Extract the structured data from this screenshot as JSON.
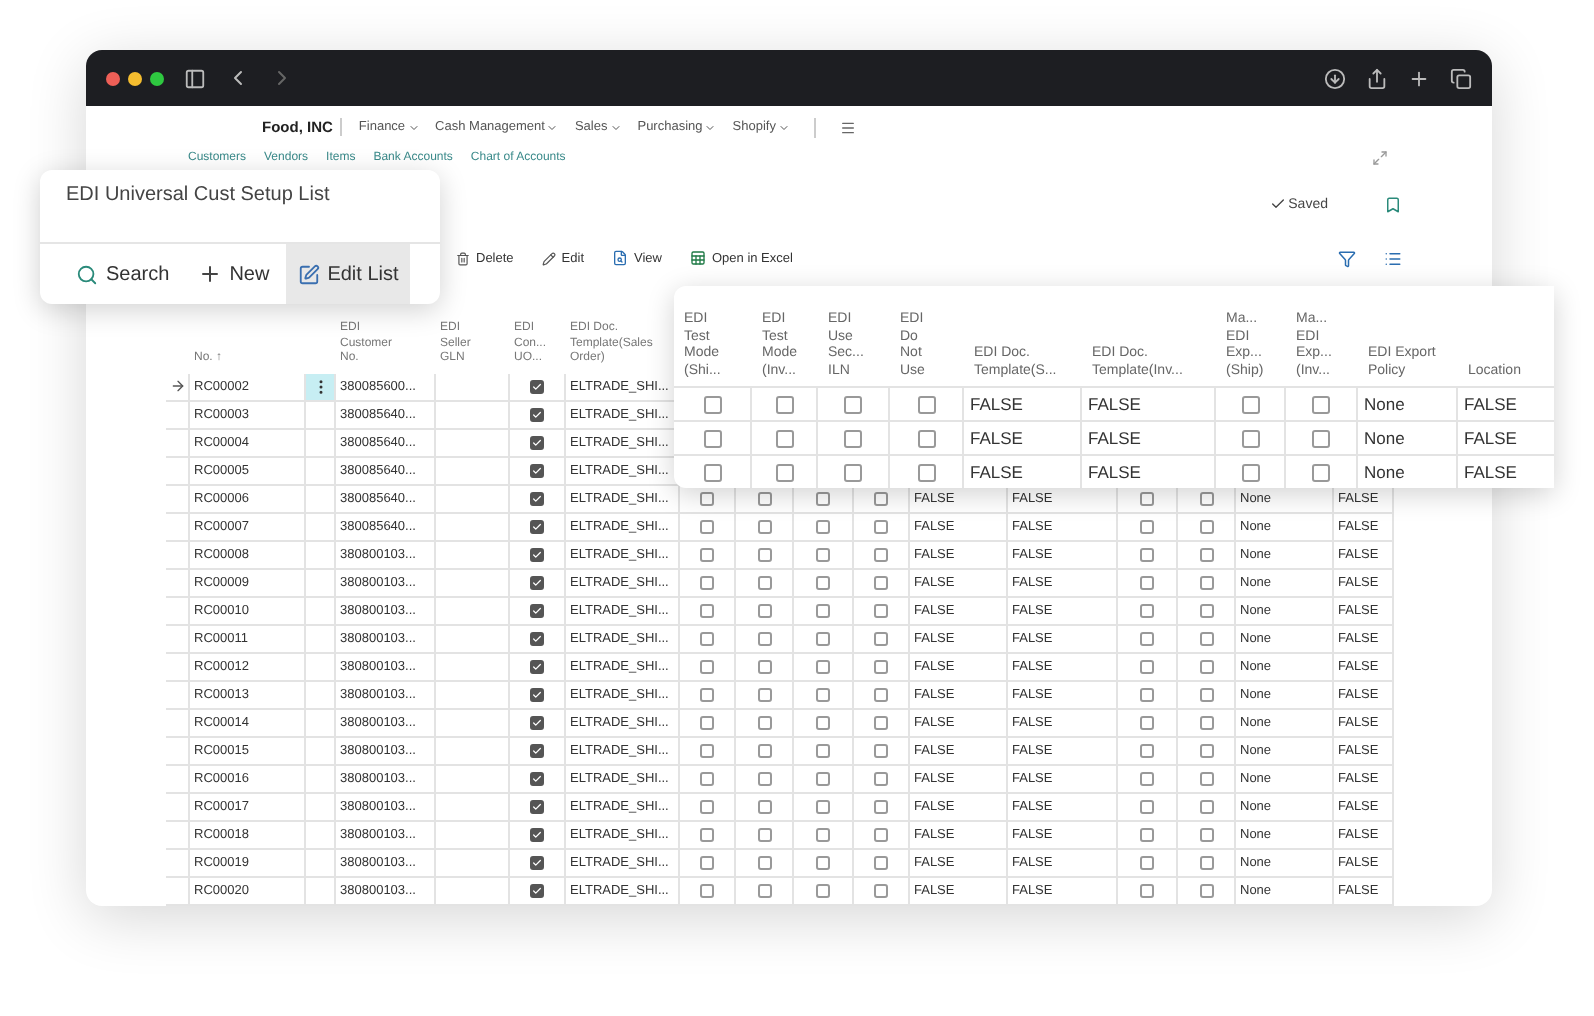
{
  "company": "Food, INC",
  "menus": [
    {
      "label": "Finance"
    },
    {
      "label": "Cash Management"
    },
    {
      "label": "Sales"
    },
    {
      "label": "Purchasing"
    },
    {
      "label": "Shopify"
    }
  ],
  "links": [
    "Customers",
    "Vendors",
    "Items",
    "Bank Accounts",
    "Chart of Accounts"
  ],
  "status": "Saved",
  "toolbar": [
    "Delete",
    "Edit",
    "View",
    "Open in Excel"
  ],
  "card": {
    "title": "EDI Universal Cust Setup List",
    "actions": [
      {
        "label": "Search",
        "kind": "search",
        "selected": false
      },
      {
        "label": "New",
        "kind": "new",
        "selected": false
      },
      {
        "label": "Edit List",
        "kind": "edit",
        "selected": true
      }
    ]
  },
  "table": {
    "columns": [
      "No. ↑",
      "EDI\nCustomer\nNo.",
      "EDI\nSeller\nGLN",
      "EDI\nCon...\nUO...",
      "EDI Doc.\nTemplate(Sales\nOrder)"
    ],
    "rows": [
      {
        "no": "RC00002",
        "customer_no": "380085600...",
        "con_uo": true,
        "template": "ELTRADE_SHI...",
        "selected": true
      },
      {
        "no": "RC00003",
        "customer_no": "380085640...",
        "con_uo": true,
        "template": "ELTRADE_SHI...",
        "selected": false
      },
      {
        "no": "RC00004",
        "customer_no": "380085640...",
        "con_uo": true,
        "template": "ELTRADE_SHI...",
        "selected": false
      },
      {
        "no": "RC00005",
        "customer_no": "380085640...",
        "con_uo": true,
        "template": "ELTRADE_SHI...",
        "selected": false
      },
      {
        "no": "RC00006",
        "customer_no": "380085640...",
        "con_uo": true,
        "template": "ELTRADE_SHI...",
        "selected": false,
        "more": {
          "test_ship": false,
          "test_inv": false,
          "use_sec": false,
          "do_not_use": false,
          "tpl_s": "FALSE",
          "tpl_inv": "FALSE",
          "ma_ship": false,
          "ma_inv": false,
          "policy": "None",
          "location": "FALSE"
        }
      },
      {
        "no": "RC00007",
        "customer_no": "380085640...",
        "con_uo": true,
        "template": "ELTRADE_SHI...",
        "selected": false,
        "more": {
          "test_ship": false,
          "test_inv": false,
          "use_sec": false,
          "do_not_use": false,
          "tpl_s": "FALSE",
          "tpl_inv": "FALSE",
          "ma_ship": false,
          "ma_inv": false,
          "policy": "None",
          "location": "FALSE"
        }
      },
      {
        "no": "RC00008",
        "customer_no": "380800103...",
        "con_uo": true,
        "template": "ELTRADE_SHI...",
        "selected": false,
        "more": {
          "test_ship": false,
          "test_inv": false,
          "use_sec": false,
          "do_not_use": false,
          "tpl_s": "FALSE",
          "tpl_inv": "FALSE",
          "ma_ship": false,
          "ma_inv": false,
          "policy": "None",
          "location": "FALSE"
        }
      },
      {
        "no": "RC00009",
        "customer_no": "380800103...",
        "con_uo": true,
        "template": "ELTRADE_SHI...",
        "selected": false,
        "more": {
          "test_ship": false,
          "test_inv": false,
          "use_sec": false,
          "do_not_use": false,
          "tpl_s": "FALSE",
          "tpl_inv": "FALSE",
          "ma_ship": false,
          "ma_inv": false,
          "policy": "None",
          "location": "FALSE"
        }
      },
      {
        "no": "RC00010",
        "customer_no": "380800103...",
        "con_uo": true,
        "template": "ELTRADE_SHI...",
        "selected": false,
        "more": {
          "test_ship": false,
          "test_inv": false,
          "use_sec": false,
          "do_not_use": false,
          "tpl_s": "FALSE",
          "tpl_inv": "FALSE",
          "ma_ship": false,
          "ma_inv": false,
          "policy": "None",
          "location": "FALSE"
        }
      },
      {
        "no": "RC00011",
        "customer_no": "380800103...",
        "con_uo": true,
        "template": "ELTRADE_SHI...",
        "selected": false,
        "more": {
          "test_ship": false,
          "test_inv": false,
          "use_sec": false,
          "do_not_use": false,
          "tpl_s": "FALSE",
          "tpl_inv": "FALSE",
          "ma_ship": false,
          "ma_inv": false,
          "policy": "None",
          "location": "FALSE"
        }
      },
      {
        "no": "RC00012",
        "customer_no": "380800103...",
        "con_uo": true,
        "template": "ELTRADE_SHI...",
        "selected": false,
        "more": {
          "test_ship": false,
          "test_inv": false,
          "use_sec": false,
          "do_not_use": false,
          "tpl_s": "FALSE",
          "tpl_inv": "FALSE",
          "ma_ship": false,
          "ma_inv": false,
          "policy": "None",
          "location": "FALSE"
        }
      },
      {
        "no": "RC00013",
        "customer_no": "380800103...",
        "con_uo": true,
        "template": "ELTRADE_SHI...",
        "selected": false,
        "more": {
          "test_ship": false,
          "test_inv": false,
          "use_sec": false,
          "do_not_use": false,
          "tpl_s": "FALSE",
          "tpl_inv": "FALSE",
          "ma_ship": false,
          "ma_inv": false,
          "policy": "None",
          "location": "FALSE"
        }
      },
      {
        "no": "RC00014",
        "customer_no": "380800103...",
        "con_uo": true,
        "template": "ELTRADE_SHI...",
        "selected": false,
        "more": {
          "test_ship": false,
          "test_inv": false,
          "use_sec": false,
          "do_not_use": false,
          "tpl_s": "FALSE",
          "tpl_inv": "FALSE",
          "ma_ship": false,
          "ma_inv": false,
          "policy": "None",
          "location": "FALSE"
        }
      },
      {
        "no": "RC00015",
        "customer_no": "380800103...",
        "con_uo": true,
        "template": "ELTRADE_SHI...",
        "selected": false,
        "more": {
          "test_ship": false,
          "test_inv": false,
          "use_sec": false,
          "do_not_use": false,
          "tpl_s": "FALSE",
          "tpl_inv": "FALSE",
          "ma_ship": false,
          "ma_inv": false,
          "policy": "None",
          "location": "FALSE"
        }
      },
      {
        "no": "RC00016",
        "customer_no": "380800103...",
        "con_uo": true,
        "template": "ELTRADE_SHI...",
        "selected": false,
        "more": {
          "test_ship": false,
          "test_inv": false,
          "use_sec": false,
          "do_not_use": false,
          "tpl_s": "FALSE",
          "tpl_inv": "FALSE",
          "ma_ship": false,
          "ma_inv": false,
          "policy": "None",
          "location": "FALSE"
        }
      },
      {
        "no": "RC00017",
        "customer_no": "380800103...",
        "con_uo": true,
        "template": "ELTRADE_SHI...",
        "selected": false,
        "more": {
          "test_ship": false,
          "test_inv": false,
          "use_sec": false,
          "do_not_use": false,
          "tpl_s": "FALSE",
          "tpl_inv": "FALSE",
          "ma_ship": false,
          "ma_inv": false,
          "policy": "None",
          "location": "FALSE"
        }
      },
      {
        "no": "RC00018",
        "customer_no": "380800103...",
        "con_uo": true,
        "template": "ELTRADE_SHI...",
        "selected": false,
        "more": {
          "test_ship": false,
          "test_inv": false,
          "use_sec": false,
          "do_not_use": false,
          "tpl_s": "FALSE",
          "tpl_inv": "FALSE",
          "ma_ship": false,
          "ma_inv": false,
          "policy": "None",
          "location": "FALSE"
        }
      },
      {
        "no": "RC00019",
        "customer_no": "380800103...",
        "con_uo": true,
        "template": "ELTRADE_SHI...",
        "selected": false,
        "more": {
          "test_ship": false,
          "test_inv": false,
          "use_sec": false,
          "do_not_use": false,
          "tpl_s": "FALSE",
          "tpl_inv": "FALSE",
          "ma_ship": false,
          "ma_inv": false,
          "policy": "None",
          "location": "FALSE"
        }
      },
      {
        "no": "RC00020",
        "customer_no": "380800103...",
        "con_uo": true,
        "template": "ELTRADE_SHI...",
        "selected": false,
        "more": {
          "test_ship": false,
          "test_inv": false,
          "use_sec": false,
          "do_not_use": false,
          "tpl_s": "FALSE",
          "tpl_inv": "FALSE",
          "ma_ship": false,
          "ma_inv": false,
          "policy": "None",
          "location": "FALSE"
        }
      }
    ]
  },
  "zoom_panel": {
    "columns": [
      "EDI\nTest\nMode\n(Shi...",
      "EDI\nTest\nMode\n(Inv...",
      "EDI\nUse\nSec...\nILN",
      "EDI\nDo\nNot\nUse",
      "EDI Doc.\nTemplate(S...",
      "EDI Doc.\nTemplate(Inv...",
      "Ma...\nEDI\nExp...\n(Ship)",
      "Ma...\nEDI\nExp...\n(Inv...",
      "EDI Export\nPolicy",
      "Location"
    ],
    "rows": [
      {
        "test_ship": false,
        "test_inv": false,
        "use_sec": false,
        "do_not_use": false,
        "tpl_s": "FALSE",
        "tpl_inv": "FALSE",
        "ma_ship": false,
        "ma_inv": false,
        "policy": "None",
        "location": "FALSE"
      },
      {
        "test_ship": false,
        "test_inv": false,
        "use_sec": false,
        "do_not_use": false,
        "tpl_s": "FALSE",
        "tpl_inv": "FALSE",
        "ma_ship": false,
        "ma_inv": false,
        "policy": "None",
        "location": "FALSE"
      },
      {
        "test_ship": false,
        "test_inv": false,
        "use_sec": false,
        "do_not_use": false,
        "tpl_s": "FALSE",
        "tpl_inv": "FALSE",
        "ma_ship": false,
        "ma_inv": false,
        "policy": "None",
        "location": "FALSE"
      }
    ]
  }
}
